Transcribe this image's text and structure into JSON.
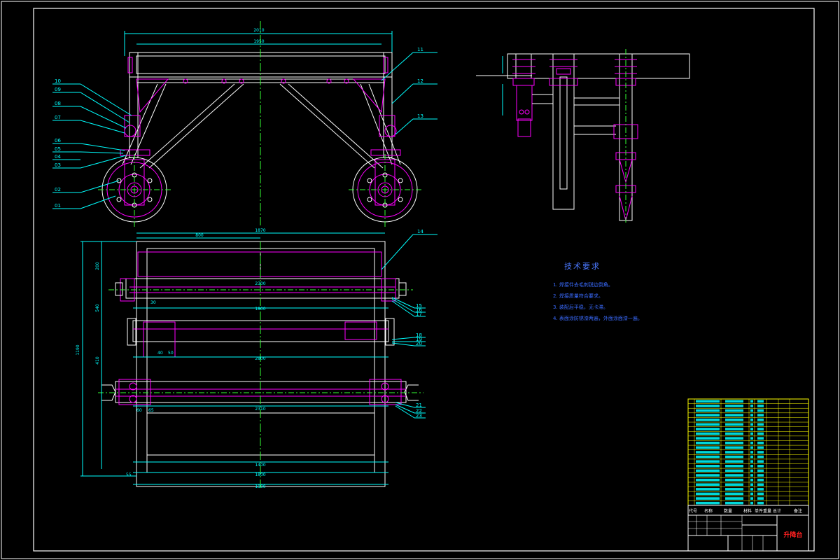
{
  "drawing": {
    "title_cn": "升降台",
    "part_numbers": [
      "01",
      "02",
      "03",
      "04",
      "05",
      "06",
      "07",
      "08",
      "09",
      "10",
      "11",
      "12",
      "13",
      "14",
      "15",
      "16",
      "17",
      "18",
      "19",
      "20",
      "21",
      "22",
      "23"
    ],
    "dims_front": {
      "overall": "2010",
      "inner": "1950"
    },
    "dims_plan": {
      "top": "1870",
      "mid1": "2300",
      "mid2": "1800",
      "mid3": "2800",
      "bottom1": "1400",
      "bottom2": "1800",
      "bottom3": "1900",
      "left_total": "1190",
      "left_a": "200",
      "left_b": "540",
      "left_c": "410",
      "sm1": "800",
      "sm2": "30",
      "sm3": "40",
      "sm4": "50",
      "sm5": "2310",
      "sm6": "55",
      "sm7": "60",
      "sm8": "65"
    }
  },
  "tech_requirements": {
    "title": "技术要求",
    "lines": [
      "1. 焊接件去毛刺锐边倒角。",
      "2. 焊接质量符合要求。",
      "3. 装配后平稳，无卡滞。",
      "4. 表面涂防锈漆两遍，外面涂面漆一遍。"
    ]
  },
  "title_block": {
    "name": "升降台",
    "headers": [
      "代号",
      "名称",
      "数量",
      "材料",
      "单件重量",
      "总计",
      "备注"
    ],
    "bom_rows": 23
  },
  "colors": {
    "frame": "#ffffff",
    "part": "#ff00ff",
    "dimension": "#00ffff",
    "centerline": "#33ff33",
    "leader": "#00ffff",
    "bom_fill": "#00ffff",
    "bom_grid": "#ffff00",
    "title_red": "#ff2020"
  }
}
